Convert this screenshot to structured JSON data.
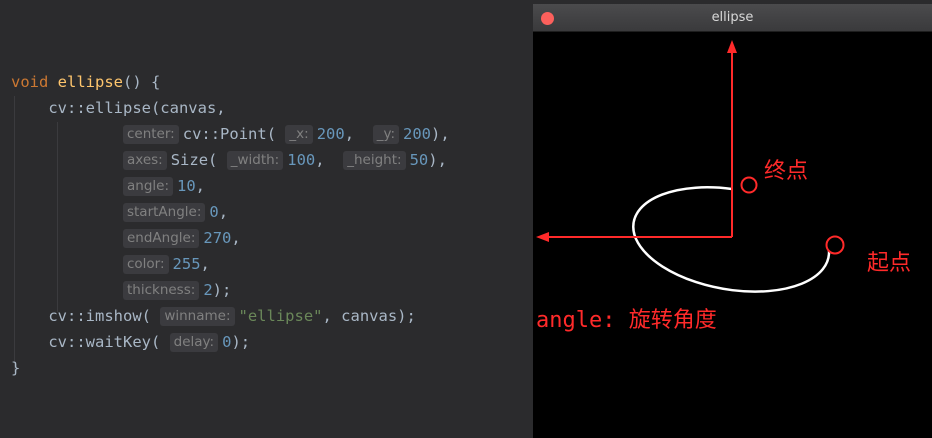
{
  "editor": {
    "lines": [
      {
        "parts": [
          {
            "t": "void ",
            "c": "kw"
          },
          {
            "t": "ellipse",
            "c": "fn"
          },
          {
            "t": "() {",
            "c": "p"
          }
        ]
      },
      {
        "parts": [
          {
            "t": "    cv::ellipse(canvas,",
            "c": "p"
          }
        ]
      },
      {
        "parts": [
          {
            "t": "            ",
            "c": "p"
          },
          {
            "t": "center:",
            "c": "hint"
          },
          {
            "t": "cv::Point( ",
            "c": "p"
          },
          {
            "t": "_x:",
            "c": "hint"
          },
          {
            "t": "200",
            "c": "num"
          },
          {
            "t": ",  ",
            "c": "p"
          },
          {
            "t": "_y:",
            "c": "hint"
          },
          {
            "t": "200",
            "c": "num"
          },
          {
            "t": "),",
            "c": "p"
          }
        ]
      },
      {
        "parts": [
          {
            "t": "            ",
            "c": "p"
          },
          {
            "t": "axes:",
            "c": "hint"
          },
          {
            "t": "Size( ",
            "c": "p"
          },
          {
            "t": "_width:",
            "c": "hint"
          },
          {
            "t": "100",
            "c": "num"
          },
          {
            "t": ",  ",
            "c": "p"
          },
          {
            "t": "_height:",
            "c": "hint"
          },
          {
            "t": "50",
            "c": "num"
          },
          {
            "t": "),",
            "c": "p"
          }
        ]
      },
      {
        "parts": [
          {
            "t": "            ",
            "c": "p"
          },
          {
            "t": "angle:",
            "c": "hint"
          },
          {
            "t": "10",
            "c": "num"
          },
          {
            "t": ",",
            "c": "p"
          }
        ]
      },
      {
        "parts": [
          {
            "t": "            ",
            "c": "p"
          },
          {
            "t": "startAngle:",
            "c": "hint"
          },
          {
            "t": "0",
            "c": "num"
          },
          {
            "t": ",",
            "c": "p"
          }
        ]
      },
      {
        "parts": [
          {
            "t": "            ",
            "c": "p"
          },
          {
            "t": "endAngle:",
            "c": "hint"
          },
          {
            "t": "270",
            "c": "num"
          },
          {
            "t": ",",
            "c": "p"
          }
        ]
      },
      {
        "parts": [
          {
            "t": "            ",
            "c": "p"
          },
          {
            "t": "color:",
            "c": "hint"
          },
          {
            "t": "255",
            "c": "num"
          },
          {
            "t": ",",
            "c": "p"
          }
        ]
      },
      {
        "parts": [
          {
            "t": "            ",
            "c": "p"
          },
          {
            "t": "thickness:",
            "c": "hint"
          },
          {
            "t": "2",
            "c": "num"
          },
          {
            "t": ");",
            "c": "p"
          }
        ]
      },
      {
        "parts": [
          {
            "t": "    cv::imshow( ",
            "c": "p"
          },
          {
            "t": "winname:",
            "c": "hint"
          },
          {
            "t": "\"ellipse\"",
            "c": "str"
          },
          {
            "t": ", canvas);",
            "c": "p"
          }
        ]
      },
      {
        "parts": [
          {
            "t": "    cv::waitKey( ",
            "c": "p"
          },
          {
            "t": "delay:",
            "c": "hint"
          },
          {
            "t": "0",
            "c": "num"
          },
          {
            "t": ");",
            "c": "p"
          }
        ]
      },
      {
        "parts": [
          {
            "t": "}",
            "c": "p"
          }
        ]
      }
    ]
  },
  "window": {
    "title": "ellipse",
    "annotations": {
      "end_point": "终点",
      "start_point": "起点",
      "angle_label": "angle: 旋转角度"
    }
  },
  "colors": {
    "background": "#2b2b2d",
    "keyword": "#cc7832",
    "function": "#ffc66d",
    "number": "#6897bb",
    "string": "#6a8759",
    "plain": "#a9b7c6",
    "hint_text": "#808080",
    "annotation": "#ff2a2a"
  }
}
